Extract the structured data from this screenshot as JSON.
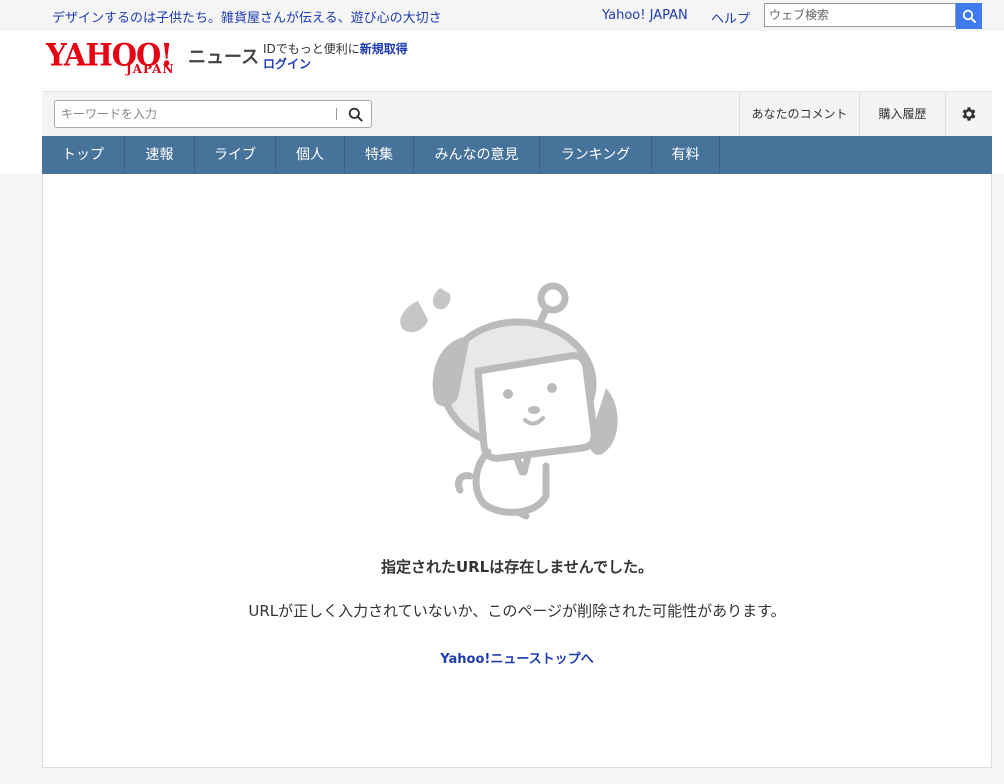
{
  "topbar": {
    "promo_text": "デザインするのは子供たち。雑貨屋さんが伝える、遊び心の大切さ",
    "links": {
      "yahoo_japan": "Yahoo! JAPAN",
      "help": "ヘルプ"
    },
    "web_search": {
      "placeholder": "ウェブ検索"
    }
  },
  "header": {
    "logo": {
      "brand": "YAHOO!",
      "sub": "JAPAN",
      "service": "ニュース"
    },
    "login": {
      "prefix": "IDでもっと便利に",
      "register": "新規取得",
      "login": "ログイン"
    }
  },
  "toolbar": {
    "search": {
      "placeholder": "キーワードを入力"
    },
    "comment": "あなたのコメント",
    "history": "購入履歴",
    "settings_icon": "gear-icon"
  },
  "categories": [
    "トップ",
    "速報",
    "ライブ",
    "個人",
    "特集",
    "みんなの意見",
    "ランキング",
    "有料"
  ],
  "error": {
    "title": "指定されたURLは存在しませんでした。",
    "description": "URLが正しく入力されていないか、このページが削除された可能性があります。",
    "top_link": "Yahoo!ニューストップへ"
  },
  "colors": {
    "brand_red": "#e60012",
    "link_blue": "#1e3bb2",
    "nav_blue": "#47729a",
    "search_button": "#3f7af0",
    "mascot_gray": "#bbbbbb"
  }
}
